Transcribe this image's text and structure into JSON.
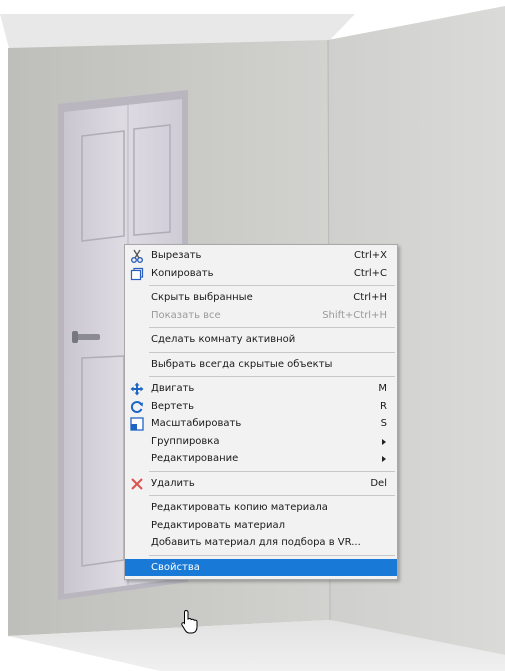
{
  "context_menu": {
    "items": [
      {
        "label": "Вырезать",
        "shortcut": "Ctrl+X",
        "icon": "scissors-icon"
      },
      {
        "label": "Копировать",
        "shortcut": "Ctrl+C",
        "icon": "copy-icon"
      },
      {
        "label": "Скрыть выбранные",
        "shortcut": "Ctrl+H"
      },
      {
        "label": "Показать все",
        "shortcut": "Shift+Ctrl+H",
        "disabled": true
      },
      {
        "label": "Сделать комнату активной"
      },
      {
        "label": "Выбрать всегда скрытые объекты"
      },
      {
        "label": "Двигать",
        "shortcut": "M",
        "icon": "move-icon"
      },
      {
        "label": "Вертеть",
        "shortcut": "R",
        "icon": "rotate-icon"
      },
      {
        "label": "Масштабировать",
        "shortcut": "S",
        "icon": "scale-icon"
      },
      {
        "label": "Группировка",
        "submenu": true
      },
      {
        "label": "Редактирование",
        "submenu": true
      },
      {
        "label": "Удалить",
        "shortcut": "Del",
        "icon": "delete-icon"
      },
      {
        "label": "Редактировать копию материала"
      },
      {
        "label": "Редактировать материал"
      },
      {
        "label": "Добавить материал для подбора в VR..."
      },
      {
        "label": "Свойства",
        "highlighted": true
      }
    ]
  },
  "colors": {
    "highlight": "#1979d6",
    "menu_background": "#f2f2f2",
    "wall_left": "#c9c9c5",
    "wall_right": "#d3d3d1",
    "floor": "#e9e9e9",
    "delete_icon": "#d9534f",
    "icon_blue": "#1f66c4"
  }
}
